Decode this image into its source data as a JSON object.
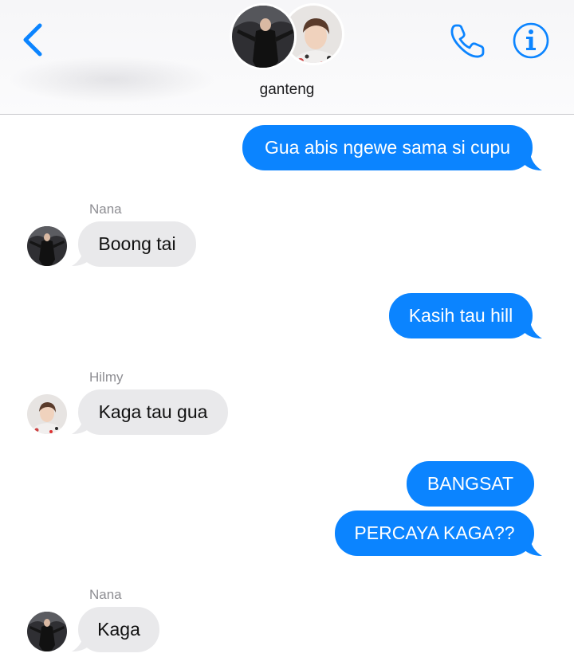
{
  "header": {
    "back_icon": "chevron-left-icon",
    "group_name": "ganteng",
    "call_icon": "phone-icon",
    "info_icon": "info-icon",
    "accent_color": "#0b84ff"
  },
  "messages": [
    {
      "direction": "outgoing",
      "text": "Gua abis ngewe sama si cupu"
    },
    {
      "direction": "incoming",
      "sender": "Nana",
      "text": "Boong tai"
    },
    {
      "direction": "outgoing",
      "text": "Kasih tau hill"
    },
    {
      "direction": "incoming",
      "sender": "Hilmy",
      "text": "Kaga tau gua"
    },
    {
      "direction": "outgoing",
      "text": "BANGSAT"
    },
    {
      "direction": "outgoing",
      "text": "PERCAYA KAGA??"
    },
    {
      "direction": "incoming",
      "sender": "Nana",
      "text": "Kaga"
    }
  ],
  "colors": {
    "outgoing_bubble": "#0b84ff",
    "incoming_bubble": "#e9e9eb",
    "sender_label": "#8e8e93"
  }
}
